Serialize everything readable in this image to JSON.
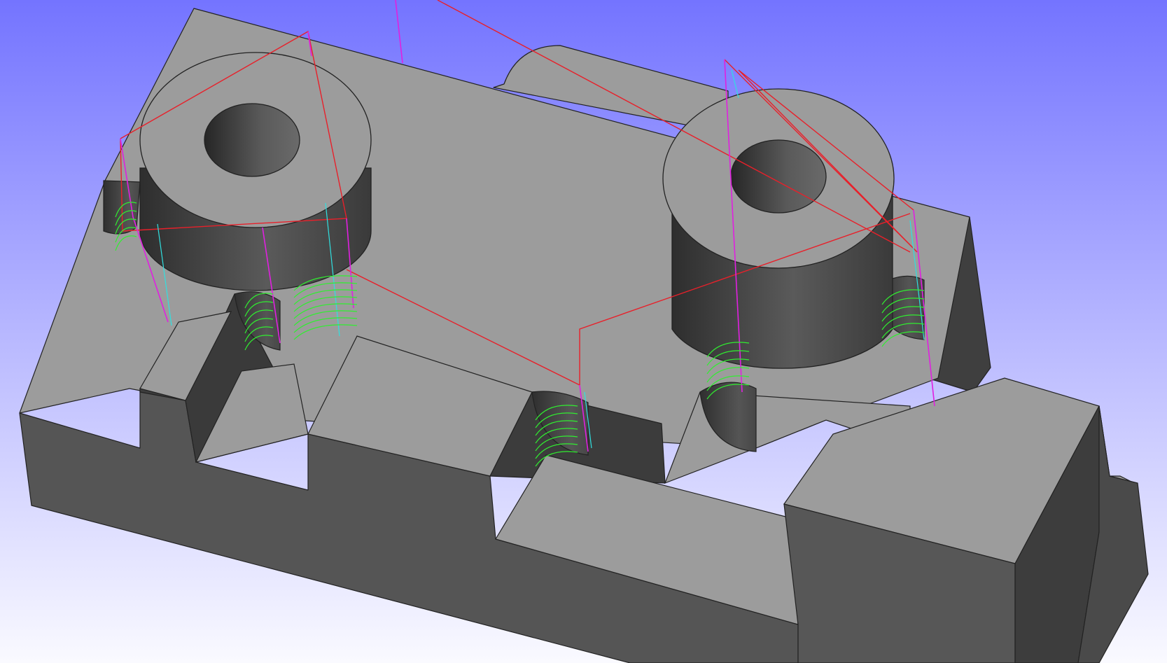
{
  "viewport": {
    "background_top": "#7474ff",
    "background_bottom": "#fafaff"
  },
  "colors": {
    "top_face": "#9c9c9c",
    "front_face": "#545454",
    "dark_face": "#3a3a3a",
    "edge": "#222222",
    "rapid_move": "#e8202a",
    "plunge_move": "#e020e0",
    "retract_move": "#30e0e0",
    "cut_move": "#30ee30"
  },
  "scene": {
    "part": "machined-block",
    "bosses": 2,
    "toolpath_legend": [
      "rapid",
      "plunge",
      "retract",
      "cut"
    ]
  }
}
